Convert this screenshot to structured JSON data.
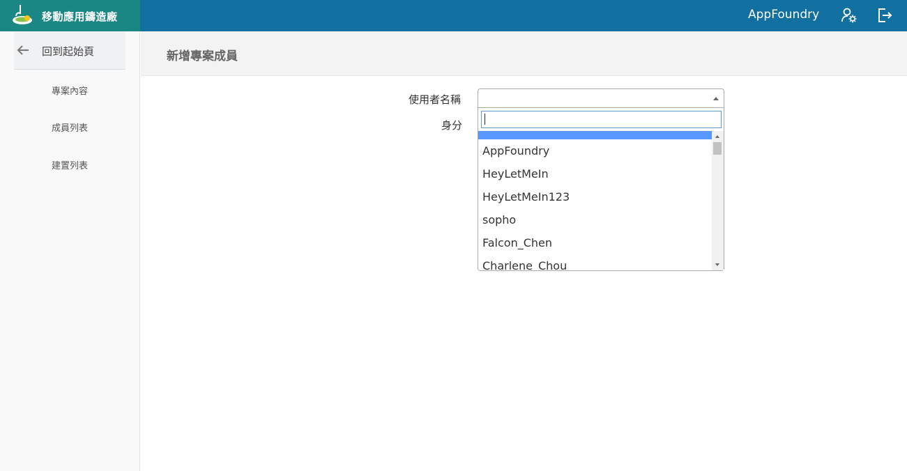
{
  "brand": {
    "title": "移動應用鑄造廠",
    "logo_icon": "app-foundry-logo"
  },
  "topbar": {
    "username": "AppFoundry",
    "settings_icon": "user-settings-icon",
    "logout_icon": "logout-icon"
  },
  "sidebar": {
    "back_label": "回到起始頁",
    "items": [
      {
        "label": "專案內容"
      },
      {
        "label": "成員列表"
      },
      {
        "label": "建置列表"
      }
    ]
  },
  "page": {
    "title": "新增專案成員"
  },
  "form": {
    "username_label": "使用者名稱",
    "role_label": "身分",
    "username_value": "",
    "search_value": "",
    "options": [
      "AppFoundry",
      "HeyLetMeIn",
      "HeyLetMeIn123",
      "sopho",
      "Falcon_Chen",
      "Charlene_Chou"
    ]
  },
  "colors": {
    "topbar": "#11709f",
    "brand": "#1a8784",
    "highlight": "#5897fb",
    "search_border": "#5b9bd5"
  }
}
